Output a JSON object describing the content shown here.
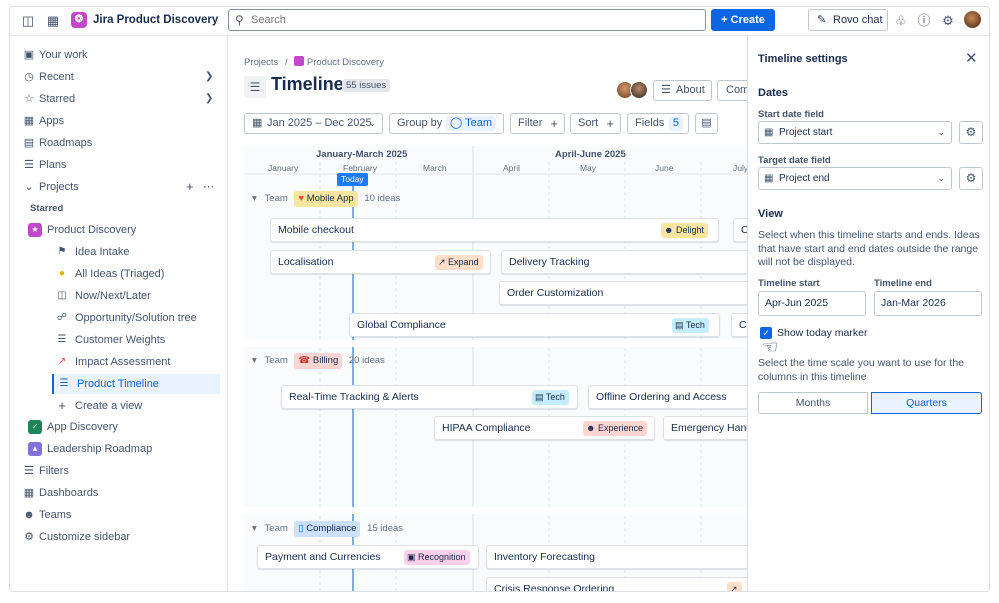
{
  "app": {
    "name": "Jira Product Discovery"
  },
  "search": {
    "placeholder": "Search"
  },
  "topbar": {
    "create_label": "Create",
    "rovo_label": "Rovo chat"
  },
  "sidebar": {
    "your_work": "Your work",
    "recent": "Recent",
    "starred": "Starred",
    "apps": "Apps",
    "roadmaps": "Roadmaps",
    "plans": "Plans",
    "projects": "Projects",
    "starred_header": "Starred",
    "product_discovery": "Product Discovery",
    "sub_items": [
      "Idea Intake",
      "All Ideas (Triaged)",
      "Now/Next/Later",
      "Opportunity/Solution tree",
      "Customer Weights",
      "Impact Assessment",
      "Product Timeline",
      "Create a view"
    ],
    "app_discovery": "App Discovery",
    "leadership_roadmap": "Leadership Roadmap",
    "filters": "Filters",
    "dashboards": "Dashboards",
    "teams": "Teams",
    "customize": "Customize sidebar"
  },
  "main": {
    "breadcrumb_projects": "Projects",
    "breadcrumb_sep": "/",
    "breadcrumb_project": "Product Discovery",
    "title": "Timeline",
    "issue_count": "55 issues",
    "about_label": "About",
    "comm_label": "Comm",
    "date_range": "Jan 2025 – Dec 2025",
    "group_by_label": "Group by",
    "group_by_value": "Team",
    "filter_label": "Filter",
    "sort_label": "Sort",
    "fields_label": "Fields",
    "fields_count": "5"
  },
  "timeline": {
    "quarter1": "January-March 2025",
    "quarter2": "April-June 2025",
    "months": [
      "January",
      "February",
      "March",
      "April",
      "May",
      "June",
      "July"
    ],
    "today": "Today",
    "groups": [
      {
        "team_label": "Team",
        "name": "Mobile App",
        "count": "10 ideas"
      },
      {
        "team_label": "Team",
        "name": "Billing",
        "count": "20 ideas"
      },
      {
        "team_label": "Team",
        "name": "Compliance",
        "count": "15 ideas"
      }
    ],
    "cards": {
      "mobile_checkout": "Mobile checkout",
      "mobile_checkout_c": "C",
      "localisation": "Localisation",
      "delivery_tracking": "Delivery Tracking",
      "order_customization": "Order Customization",
      "global_compliance": "Global Compliance",
      "global_compliance_c": "Co",
      "realtime_tracking": "Real-Time Tracking & Alerts",
      "offline_ordering": "Offline Ordering and Access",
      "hipaa": "HIPAA Compliance",
      "emergency": "Emergency Handli",
      "payment": "Payment and Currencies",
      "inventory": "Inventory Forecasting",
      "crisis": "Crisis Response Ordering"
    },
    "tags": {
      "delight": "Delight",
      "expand": "Expand",
      "tech": "Tech",
      "experience": "Experience",
      "recognition": "Recognition"
    }
  },
  "panel": {
    "title": "Timeline settings",
    "dates_heading": "Dates",
    "start_field_label": "Start date field",
    "start_field_value": "Project start",
    "target_field_label": "Target date field",
    "target_field_value": "Project end",
    "view_heading": "View",
    "view_desc": "Select when this timeline starts and ends. Ideas that have start and end dates outside the range will not be displayed.",
    "timeline_start_label": "Timeline start",
    "timeline_start_value": "Apr-Jun 2025",
    "timeline_end_label": "Timeline end",
    "timeline_end_value": "Jan-Mar 2026",
    "today_marker_label": "Show today marker",
    "today_marker_checked": true,
    "scale_desc": "Select the time scale you want to use for the columns in this timeline",
    "months_option": "Months",
    "quarters_option": "Quarters",
    "selected_scale": "Quarters"
  },
  "colors": {
    "accent": "#0c66e4",
    "today_line": "#1d7afc",
    "mobile_tag": "#f8e6a0",
    "billing_tag": "#ffd5d2",
    "compliance_tag": "#cce0ff",
    "tech_tag": "#c6edfb",
    "delight_tag": "#f8e6a0",
    "expand_tag": "#fedec8",
    "experience_tag": "#ffd5d2",
    "recognition_tag": "#fdd0ec"
  }
}
